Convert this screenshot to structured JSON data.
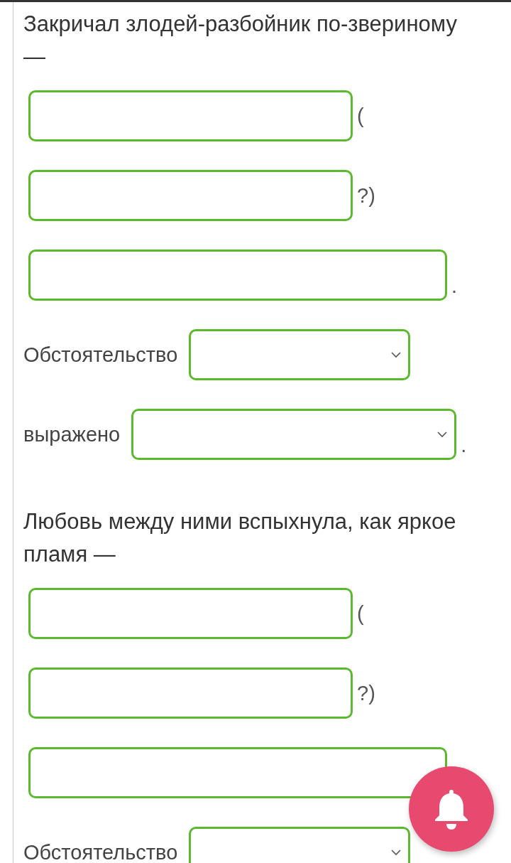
{
  "sections": [
    {
      "heading": "Закричал злодей-разбойник по-звериному —",
      "blanks": [
        {
          "kind": "short",
          "after": "("
        },
        {
          "kind": "short",
          "after": "?)"
        },
        {
          "kind": "long",
          "after": "."
        }
      ],
      "selects": [
        {
          "label": "Обстоятельство"
        },
        {
          "label": "выражено",
          "after": "."
        }
      ]
    },
    {
      "heading": "Любовь между ними вспыхнула, как яркое пламя —",
      "blanks": [
        {
          "kind": "short",
          "after": "("
        },
        {
          "kind": "short",
          "after": "?)"
        },
        {
          "kind": "long"
        }
      ],
      "selects": [
        {
          "label": "Обстоятельство"
        }
      ]
    }
  ]
}
